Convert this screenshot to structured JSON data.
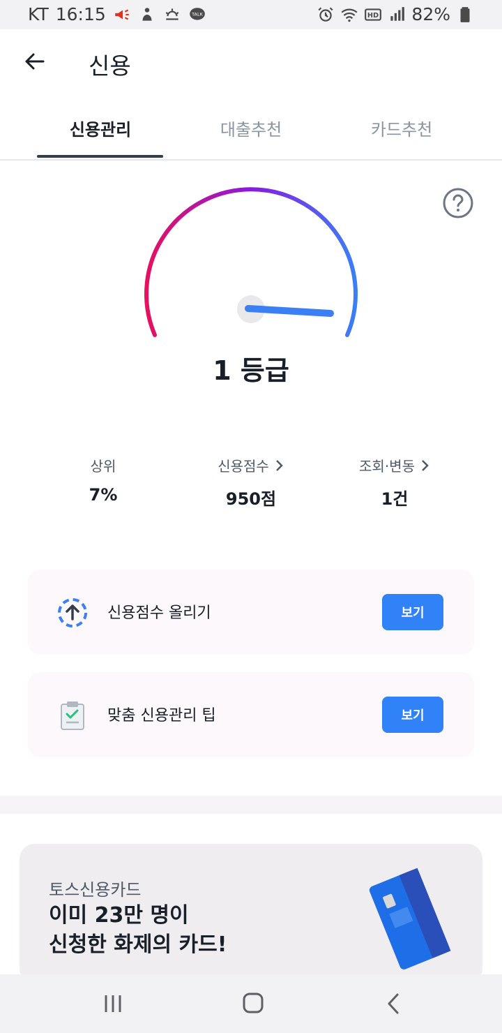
{
  "status": {
    "carrier": "KT",
    "time": "16:15",
    "battery": "82%"
  },
  "appbar": {
    "title": "신용"
  },
  "tabs": [
    {
      "label": "신용관리"
    },
    {
      "label": "대출추천"
    },
    {
      "label": "카드추천"
    }
  ],
  "gauge": {
    "grade": "1 등급"
  },
  "stats": {
    "rank": {
      "label": "상위",
      "value": "7%"
    },
    "score": {
      "label": "신용점수",
      "value": "950점"
    },
    "lookup": {
      "label": "조회·변동",
      "value": "1건"
    }
  },
  "actions": [
    {
      "label": "신용점수 올리기",
      "button": "보기"
    },
    {
      "label": "맞춤 신용관리 팁",
      "button": "보기"
    }
  ],
  "promo": {
    "sub": "토스신용카드",
    "line1": "이미 23만 명이",
    "line2": "신청한 화제의 카드!"
  },
  "colors": {
    "accent": "#3182f6",
    "gauge_start": "#e6115f",
    "gauge_mid": "#8a19e0",
    "gauge_end": "#3b7ff5"
  }
}
